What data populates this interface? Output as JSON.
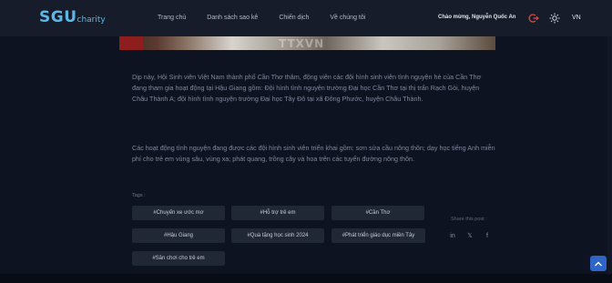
{
  "header": {
    "logo_main": "SGU",
    "logo_sub": "charity",
    "nav": [
      "Trang chủ",
      "Danh sách sao kê",
      "Chiến dịch",
      "Về chúng tôi"
    ],
    "welcome": "Chào mừng, Nguyễn Quốc An",
    "language": "VN",
    "icons": [
      "logout-icon",
      "sun-icon"
    ]
  },
  "hero": {
    "watermark": "TTXVN"
  },
  "article": {
    "paragraph1": "Dịp này, Hội Sinh viên Việt Nam thành phố Cần Thơ thăm, động viên các đội hình sinh viên tình nguyện hè của Cần Thơ đang tham gia hoạt động tại Hậu Giang gồm: Đội hình tình nguyện trường Đại học Cần Thơ tại thị trấn Rạch Gòi, huyện Châu Thành A; đội hình tình nguyện trường Đại học Tây Đô tại xã Đông Phước, huyện Châu Thành.",
    "paragraph2": "Các hoạt động tình nguyện đang được các đội hình sinh viên triển khai gồm: sơn sửa cầu nông thôn; dạy học tiếng Anh miễn phí cho trẻ em vùng sâu, vùng xa; phát quang, trồng cây và hoa trên các tuyến đường nông thôn."
  },
  "tags": {
    "title": "Tags :",
    "items": [
      "#Chuyến xe ước mơ",
      "#Hỗ trợ trẻ em",
      "#Cần Thơ",
      "#Hậu Giang",
      "#Quà tặng học sinh 2024",
      "#Phát triển giáo dục miền Tây",
      "#Sân chơi cho trẻ em"
    ]
  },
  "share": {
    "title": "Share this post :",
    "icons": [
      "linkedin-icon",
      "x-twitter-icon",
      "facebook-icon"
    ],
    "glyphs": [
      "in",
      "𝕏",
      "f"
    ]
  },
  "colors": {
    "accent": "#5db7e6",
    "logout": "#e0473e",
    "scroll_button": "#2f64c9"
  }
}
